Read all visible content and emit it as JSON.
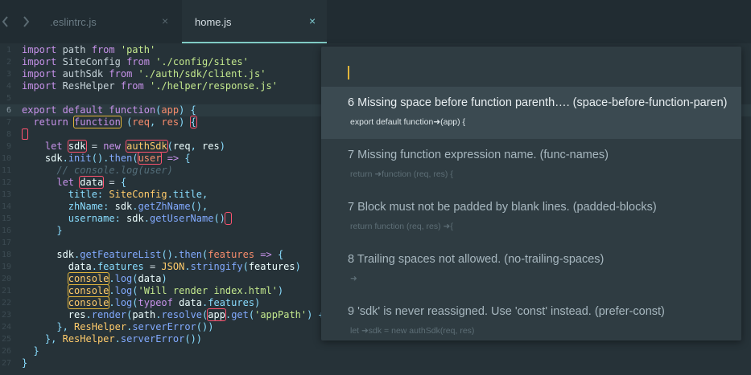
{
  "tabs": [
    {
      "label": ".eslintrc.js",
      "active": false
    },
    {
      "label": "home.js",
      "active": true
    }
  ],
  "tab_close_glyph": "×",
  "gutter": {
    "line_numbers": [
      "1",
      "2",
      "3",
      "4",
      "5",
      "6",
      "7",
      "8",
      "9",
      "10",
      "11",
      "12",
      "13",
      "14",
      "15",
      "16",
      "17",
      "18",
      "19",
      "20",
      "21",
      "22",
      "23",
      "24",
      "25",
      "26",
      "27"
    ],
    "active_line": "6"
  },
  "code": [
    [
      [
        "kw",
        "import"
      ],
      [
        "plain",
        " path "
      ],
      [
        "kw",
        "from"
      ],
      [
        "plain",
        " "
      ],
      [
        "str",
        "'path'"
      ]
    ],
    [
      [
        "kw",
        "import"
      ],
      [
        "plain",
        " SiteConfig "
      ],
      [
        "kw",
        "from"
      ],
      [
        "plain",
        " "
      ],
      [
        "str",
        "'./config/sites'"
      ]
    ],
    [
      [
        "kw",
        "import"
      ],
      [
        "plain",
        " authSdk "
      ],
      [
        "kw",
        "from"
      ],
      [
        "plain",
        " "
      ],
      [
        "str",
        "'./auth/sdk/client.js'"
      ]
    ],
    [
      [
        "kw",
        "import"
      ],
      [
        "plain",
        " ResHelper "
      ],
      [
        "kw",
        "from"
      ],
      [
        "plain",
        " "
      ],
      [
        "str",
        "'./helper/response.js'"
      ]
    ],
    [],
    [
      [
        "kw",
        "export default "
      ],
      [
        "kw",
        "function"
      ],
      [
        "punc",
        "("
      ],
      [
        "param",
        "app"
      ],
      [
        "punc",
        ") {"
      ]
    ],
    [
      [
        "plain",
        "  "
      ],
      [
        "kw",
        "return "
      ],
      [
        "kw mark-y",
        "function"
      ],
      [
        "plain",
        " "
      ],
      [
        "punc",
        "("
      ],
      [
        "param",
        "req"
      ],
      [
        "punc",
        ", "
      ],
      [
        "param",
        "res"
      ],
      [
        "punc",
        ") "
      ],
      [
        "punc mark-r",
        "{"
      ]
    ],
    [
      [
        "cursor",
        ""
      ]
    ],
    [
      [
        "plain",
        "    "
      ],
      [
        "kw",
        "let "
      ],
      [
        "var mark-r",
        "sdk"
      ],
      [
        "plain",
        " = "
      ],
      [
        "kw",
        "new "
      ],
      [
        "cls mark-r",
        "authSdk"
      ],
      [
        "punc",
        "("
      ],
      [
        "var",
        "req"
      ],
      [
        "punc",
        ", "
      ],
      [
        "var",
        "res"
      ],
      [
        "punc",
        ")"
      ]
    ],
    [
      [
        "plain",
        "    "
      ],
      [
        "var",
        "sdk"
      ],
      [
        "punc",
        "."
      ],
      [
        "fn",
        "init"
      ],
      [
        "punc",
        "()."
      ],
      [
        "fn",
        "then"
      ],
      [
        "punc",
        "("
      ],
      [
        "param mark-r",
        "user"
      ],
      [
        "plain",
        " "
      ],
      [
        "kw",
        "=>"
      ],
      [
        "punc",
        " {"
      ]
    ],
    [
      [
        "plain",
        "      "
      ],
      [
        "cmt",
        "// console.log(user)"
      ]
    ],
    [
      [
        "plain",
        "      "
      ],
      [
        "kw",
        "let "
      ],
      [
        "var mark-r",
        "data"
      ],
      [
        "plain",
        " = "
      ],
      [
        "punc",
        "{"
      ]
    ],
    [
      [
        "plain",
        "        "
      ],
      [
        "prop",
        "title"
      ],
      [
        "punc",
        ": "
      ],
      [
        "cls",
        "SiteConfig"
      ],
      [
        "punc",
        "."
      ],
      [
        "prop",
        "title"
      ],
      [
        "punc",
        ","
      ]
    ],
    [
      [
        "plain",
        "        "
      ],
      [
        "prop",
        "zhName"
      ],
      [
        "punc",
        ": "
      ],
      [
        "var",
        "sdk"
      ],
      [
        "punc",
        "."
      ],
      [
        "fn",
        "getZhName"
      ],
      [
        "punc",
        "(),"
      ]
    ],
    [
      [
        "plain",
        "        "
      ],
      [
        "prop",
        "username"
      ],
      [
        "punc",
        ": "
      ],
      [
        "var",
        "sdk"
      ],
      [
        "punc",
        "."
      ],
      [
        "fn",
        "getUserName"
      ],
      [
        "punc",
        "()"
      ],
      [
        "punc mark-r",
        " "
      ]
    ],
    [
      [
        "plain",
        "      "
      ],
      [
        "punc",
        "}"
      ]
    ],
    [],
    [
      [
        "plain",
        "      "
      ],
      [
        "var",
        "sdk"
      ],
      [
        "punc",
        "."
      ],
      [
        "fn",
        "getFeatureList"
      ],
      [
        "punc",
        "()."
      ],
      [
        "fn",
        "then"
      ],
      [
        "punc",
        "("
      ],
      [
        "param",
        "features"
      ],
      [
        "plain",
        " "
      ],
      [
        "kw",
        "=>"
      ],
      [
        "punc",
        " {"
      ]
    ],
    [
      [
        "plain",
        "        "
      ],
      [
        "var",
        "data"
      ],
      [
        "punc",
        "."
      ],
      [
        "prop",
        "features"
      ],
      [
        "plain",
        " = "
      ],
      [
        "cls",
        "JSON"
      ],
      [
        "punc",
        "."
      ],
      [
        "fn",
        "stringify"
      ],
      [
        "punc",
        "("
      ],
      [
        "var",
        "features"
      ],
      [
        "punc",
        ")"
      ]
    ],
    [
      [
        "plain",
        "        "
      ],
      [
        "cls mark-y",
        "console"
      ],
      [
        "punc",
        "."
      ],
      [
        "fn",
        "log"
      ],
      [
        "punc",
        "("
      ],
      [
        "var",
        "data"
      ],
      [
        "punc",
        ")"
      ]
    ],
    [
      [
        "plain",
        "        "
      ],
      [
        "cls mark-y",
        "console"
      ],
      [
        "punc",
        "."
      ],
      [
        "fn",
        "log"
      ],
      [
        "punc",
        "("
      ],
      [
        "str",
        "'Will render index.html'"
      ],
      [
        "punc",
        ")"
      ]
    ],
    [
      [
        "plain",
        "        "
      ],
      [
        "cls mark-y",
        "console"
      ],
      [
        "punc",
        "."
      ],
      [
        "fn",
        "log"
      ],
      [
        "punc",
        "("
      ],
      [
        "kw",
        "typeof "
      ],
      [
        "var",
        "data"
      ],
      [
        "punc",
        "."
      ],
      [
        "prop",
        "features"
      ],
      [
        "punc",
        ")"
      ]
    ],
    [
      [
        "plain",
        "        "
      ],
      [
        "var",
        "res"
      ],
      [
        "punc",
        "."
      ],
      [
        "fn",
        "render"
      ],
      [
        "punc",
        "("
      ],
      [
        "var",
        "path"
      ],
      [
        "punc",
        "."
      ],
      [
        "fn",
        "resolve"
      ],
      [
        "punc",
        "("
      ],
      [
        "var mark-r",
        "app"
      ],
      [
        "punc",
        "."
      ],
      [
        "fn",
        "get"
      ],
      [
        "punc",
        "("
      ],
      [
        "str",
        "'appPath'"
      ],
      [
        "punc",
        ") +"
      ]
    ],
    [
      [
        "plain",
        "      "
      ],
      [
        "punc",
        "}, "
      ],
      [
        "cls",
        "ResHelper"
      ],
      [
        "punc",
        "."
      ],
      [
        "fn",
        "serverError"
      ],
      [
        "punc",
        "())"
      ]
    ],
    [
      [
        "plain",
        "    "
      ],
      [
        "punc",
        "}, "
      ],
      [
        "cls",
        "ResHelper"
      ],
      [
        "punc",
        "."
      ],
      [
        "fn",
        "serverError"
      ],
      [
        "punc",
        "())"
      ]
    ],
    [
      [
        "plain",
        "  "
      ],
      [
        "punc",
        "}"
      ]
    ],
    [
      [
        "punc",
        "}"
      ]
    ]
  ],
  "popup": {
    "input_value": "",
    "results": [
      {
        "title": "6  Missing space before function parenth…. (space-before-function-paren)",
        "sub": "export default function➜(app) {",
        "selected": true
      },
      {
        "title": "7  Missing function expression name. (func-names)",
        "sub": "return ➜function (req, res) {",
        "selected": false
      },
      {
        "title": "7  Block must not be padded by blank lines. (padded-blocks)",
        "sub": "return function (req, res) ➜{",
        "selected": false
      },
      {
        "title": "8  Trailing spaces not allowed. (no-trailing-spaces)",
        "sub": "➜",
        "selected": false
      },
      {
        "title": "9  'sdk' is never reassigned. Use 'const' instead. (prefer-const)",
        "sub": "let ➜sdk = new authSdk(req, res)",
        "selected": false
      }
    ]
  },
  "colors": {
    "background": "#263238",
    "tab_accent": "#80cbc4",
    "warning_mark": "#e2b53a",
    "error_mark": "#ff5370",
    "popup_bg": "#2f3c42",
    "popup_selected": "#3b4a51"
  },
  "icons": [
    "chevron-left-icon",
    "chevron-right-icon",
    "close-icon"
  ]
}
